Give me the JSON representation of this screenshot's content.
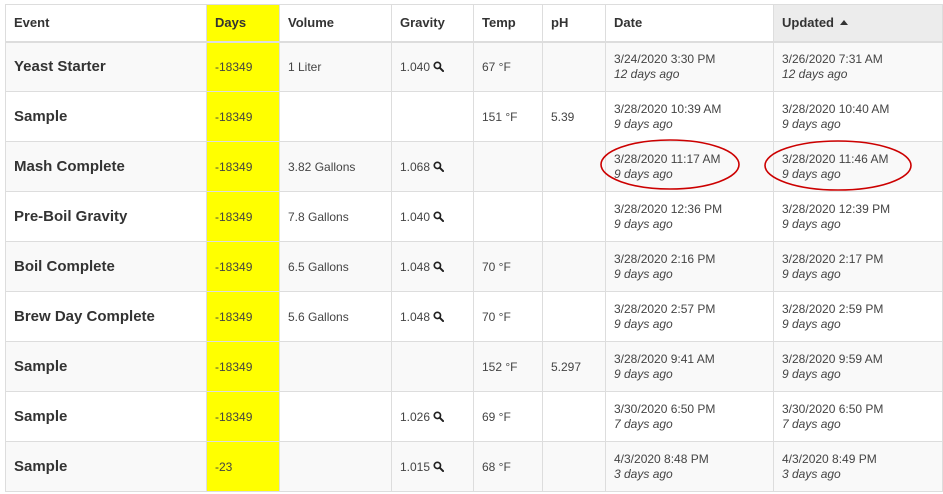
{
  "columns": {
    "event": "Event",
    "days": "Days",
    "volume": "Volume",
    "gravity": "Gravity",
    "temp": "Temp",
    "ph": "pH",
    "date": "Date",
    "updated": "Updated"
  },
  "sort": {
    "column": "updated",
    "direction": "ascending"
  },
  "highlight_color": "#ffff00",
  "annotation_color": "#cc0000",
  "icons": {
    "gravity_lookup": "search-icon",
    "sort_indicator": "sort-asc-icon"
  },
  "rows": [
    {
      "event": "Yeast Starter",
      "days": "-18349",
      "volume": "1 Liter",
      "gravity": "1.040",
      "temp": "67 °F",
      "ph": "",
      "date": "3/24/2020 3:30 PM",
      "date_ago": "12 days ago",
      "updated": "3/26/2020 7:31 AM",
      "updated_ago": "12 days ago"
    },
    {
      "event": "Sample",
      "days": "-18349",
      "volume": "",
      "gravity": "",
      "temp": "151 °F",
      "ph": "5.39",
      "date": "3/28/2020 10:39 AM",
      "date_ago": "9 days ago",
      "updated": "3/28/2020 10:40 AM",
      "updated_ago": "9 days ago"
    },
    {
      "event": "Mash Complete",
      "days": "-18349",
      "volume": "3.82 Gallons",
      "gravity": "1.068",
      "temp": "",
      "ph": "",
      "date": "3/28/2020 11:17 AM",
      "date_ago": "9 days ago",
      "updated": "3/28/2020 11:46 AM",
      "updated_ago": "9 days ago"
    },
    {
      "event": "Pre-Boil Gravity",
      "days": "-18349",
      "volume": "7.8 Gallons",
      "gravity": "1.040",
      "temp": "",
      "ph": "",
      "date": "3/28/2020 12:36 PM",
      "date_ago": "9 days ago",
      "updated": "3/28/2020 12:39 PM",
      "updated_ago": "9 days ago"
    },
    {
      "event": "Boil Complete",
      "days": "-18349",
      "volume": "6.5 Gallons",
      "gravity": "1.048",
      "temp": "70 °F",
      "ph": "",
      "date": "3/28/2020 2:16 PM",
      "date_ago": "9 days ago",
      "updated": "3/28/2020 2:17 PM",
      "updated_ago": "9 days ago"
    },
    {
      "event": "Brew Day Complete",
      "days": "-18349",
      "volume": "5.6 Gallons",
      "gravity": "1.048",
      "temp": "70 °F",
      "ph": "",
      "date": "3/28/2020 2:57 PM",
      "date_ago": "9 days ago",
      "updated": "3/28/2020 2:59 PM",
      "updated_ago": "9 days ago"
    },
    {
      "event": "Sample",
      "days": "-18349",
      "volume": "",
      "gravity": "",
      "temp": "152 °F",
      "ph": "5.297",
      "date": "3/28/2020 9:41 AM",
      "date_ago": "9 days ago",
      "updated": "3/28/2020 9:59 AM",
      "updated_ago": "9 days ago"
    },
    {
      "event": "Sample",
      "days": "-18349",
      "volume": "",
      "gravity": "1.026",
      "temp": "69 °F",
      "ph": "",
      "date": "3/30/2020 6:50 PM",
      "date_ago": "7 days ago",
      "updated": "3/30/2020 6:50 PM",
      "updated_ago": "7 days ago"
    },
    {
      "event": "Sample",
      "days": "-23",
      "volume": "",
      "gravity": "1.015",
      "temp": "68 °F",
      "ph": "",
      "date": "4/3/2020 8:48 PM",
      "date_ago": "3 days ago",
      "updated": "4/3/2020 8:49 PM",
      "updated_ago": "3 days ago"
    }
  ]
}
